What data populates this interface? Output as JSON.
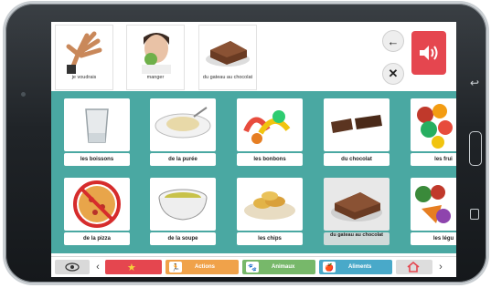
{
  "sentence": [
    {
      "label": "je voudrais",
      "icon": "hand-icon"
    },
    {
      "label": "manger",
      "icon": "eating-person-icon"
    },
    {
      "label": "du gateau au chocolat",
      "icon": "chocolate-cake-icon"
    }
  ],
  "controls": {
    "back": "←",
    "clear": "✕",
    "speaker_icon": "speaker-icon"
  },
  "tiles": [
    {
      "label": "les boissons",
      "icon": "glass-icon"
    },
    {
      "label": "de la purée",
      "icon": "puree-icon"
    },
    {
      "label": "les bonbons",
      "icon": "candy-icon"
    },
    {
      "label": "du chocolat",
      "icon": "chocolate-bar-icon"
    },
    {
      "label": "les frui",
      "icon": "fruit-icon"
    },
    {
      "label": "de la pizza",
      "icon": "no-pizza-icon"
    },
    {
      "label": "de la soupe",
      "icon": "soup-icon"
    },
    {
      "label": "les chips",
      "icon": "chips-icon"
    },
    {
      "label": "du gateau au chocolat",
      "icon": "chocolate-cake-icon"
    },
    {
      "label": "les légu",
      "icon": "vegetables-icon"
    }
  ],
  "categories": [
    {
      "label": "",
      "color": "#e5464f",
      "icon": "star-icon"
    },
    {
      "label": "Actions",
      "color": "#f0a24a",
      "icon": "actions-icon"
    },
    {
      "label": "Animaux",
      "color": "#77b86a",
      "icon": "animal-icon"
    },
    {
      "label": "Aliments",
      "color": "#49a9c9",
      "icon": "food-icon"
    },
    {
      "label": "",
      "color": "#dddddd",
      "icon": "home-icon"
    }
  ],
  "colors": {
    "grid_bg": "#4aa8a2",
    "speaker": "#e5464f"
  }
}
